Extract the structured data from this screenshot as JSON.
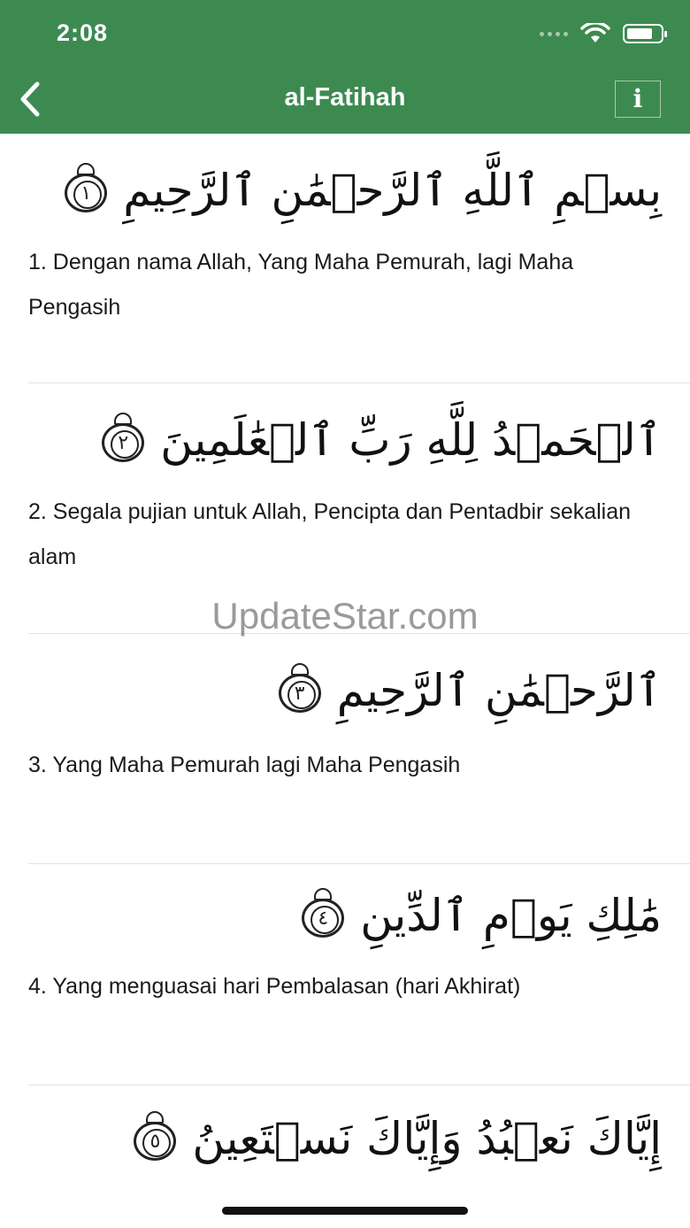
{
  "status": {
    "time": "2:08"
  },
  "nav": {
    "title": "al-Fatihah",
    "info_label": "i"
  },
  "verses": [
    {
      "arabic": "بِسۡمِ ٱللَّهِ ٱلرَّحۡمَٰنِ ٱلرَّحِيمِ",
      "number": "١",
      "translation": "1. Dengan nama Allah, Yang Maha Pemurah, lagi Maha Pengasih"
    },
    {
      "arabic": "ٱلۡحَمۡدُ لِلَّهِ رَبِّ ٱلۡعَٰلَمِينَ",
      "number": "٢",
      "translation": "2. Segala pujian untuk Allah, Pencipta dan Pentadbir sekalian alam"
    },
    {
      "arabic": "ٱلرَّحۡمَٰنِ ٱلرَّحِيمِ",
      "number": "٣",
      "translation": "3. Yang Maha Pemurah lagi Maha Pengasih"
    },
    {
      "arabic": "مَٰلِكِ يَوۡمِ ٱلدِّينِ",
      "number": "٤",
      "translation": "4. Yang menguasai hari Pembalasan (hari Akhirat)"
    },
    {
      "arabic": "إِيَّاكَ نَعۡبُدُ وَإِيَّاكَ نَسۡتَعِينُ",
      "number": "٥",
      "translation": ""
    }
  ],
  "watermark": "UpdateStar.com",
  "colors": {
    "header": "#3d8a51",
    "text": "#1a1a1a"
  },
  "icons": {
    "back": "chevron-left-icon",
    "info": "info-icon",
    "wifi": "wifi-icon",
    "battery": "battery-icon"
  }
}
